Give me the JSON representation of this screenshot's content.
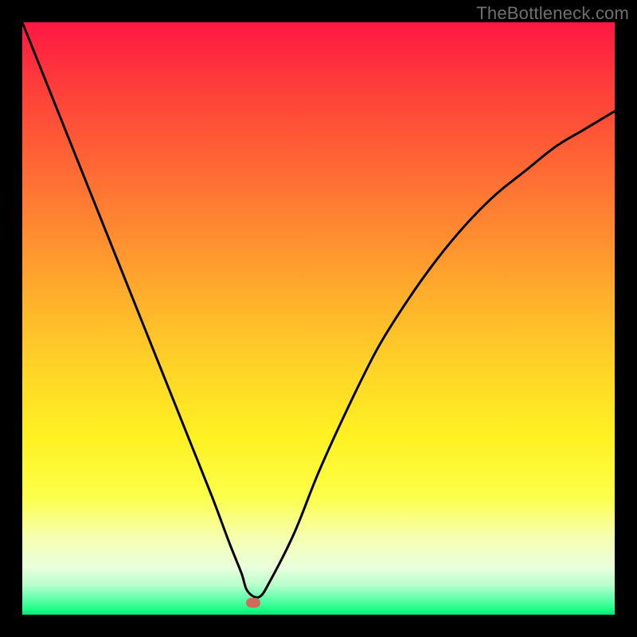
{
  "watermark": "TheBottleneck.com",
  "chart_data": {
    "type": "line",
    "title": "",
    "xlabel": "",
    "ylabel": "",
    "xlim": [
      0,
      100
    ],
    "ylim": [
      0,
      100
    ],
    "grid": false,
    "legend": false,
    "marker": {
      "x": 39,
      "y": 2
    },
    "series": [
      {
        "name": "bottleneck-curve",
        "x": [
          0,
          4,
          8,
          12,
          16,
          20,
          24,
          28,
          32,
          35,
          37,
          38,
          40,
          42,
          46,
          50,
          55,
          60,
          65,
          70,
          75,
          80,
          85,
          90,
          95,
          100
        ],
        "y": [
          100,
          90,
          80,
          70,
          60,
          50,
          40,
          30,
          20,
          12,
          7,
          4,
          3,
          6,
          14,
          24,
          35,
          45,
          53,
          60,
          66,
          71,
          75,
          79,
          82,
          85
        ]
      }
    ],
    "background_gradient": {
      "type": "vertical",
      "stops": [
        {
          "pos": 0.0,
          "color": "#ff1744"
        },
        {
          "pos": 0.1,
          "color": "#ff3b3a"
        },
        {
          "pos": 0.2,
          "color": "#ff5a36"
        },
        {
          "pos": 0.3,
          "color": "#ff7a32"
        },
        {
          "pos": 0.4,
          "color": "#ff9a2e"
        },
        {
          "pos": 0.5,
          "color": "#ffbb2a"
        },
        {
          "pos": 0.6,
          "color": "#ffd826"
        },
        {
          "pos": 0.7,
          "color": "#fff122"
        },
        {
          "pos": 0.8,
          "color": "#fcff4a"
        },
        {
          "pos": 0.87,
          "color": "#f6ffb0"
        },
        {
          "pos": 0.92,
          "color": "#eaffdc"
        },
        {
          "pos": 0.95,
          "color": "#b8ffcc"
        },
        {
          "pos": 0.97,
          "color": "#6cffb0"
        },
        {
          "pos": 0.99,
          "color": "#22ff88"
        },
        {
          "pos": 1.0,
          "color": "#00e676"
        }
      ]
    }
  }
}
